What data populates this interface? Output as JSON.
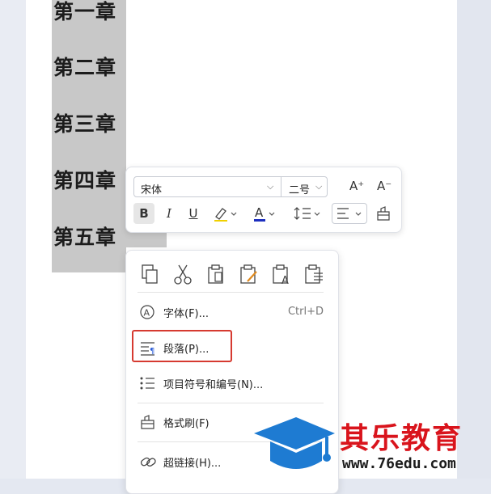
{
  "document": {
    "chapters": [
      "第一章",
      "第二章",
      "第三章",
      "第四章",
      "第五章"
    ]
  },
  "toolbar": {
    "font_name": "宋体",
    "font_size": "二号",
    "grow_label": "A⁺",
    "shrink_label": "A⁻",
    "bold_label": "B",
    "italic_label": "I",
    "underline_label": "U",
    "font_color": "#1d2fbf",
    "highlight_color": "#f0d000"
  },
  "context_menu": {
    "items": [
      {
        "label": "字体(F)...",
        "shortcut": "Ctrl+D",
        "icon": "font-circle-icon"
      },
      {
        "label": "段落(P)...",
        "icon": "paragraph-icon"
      },
      {
        "label": "项目符号和编号(N)...",
        "icon": "bullet-list-icon"
      },
      {
        "label": "格式刷(F)",
        "icon": "format-painter-icon"
      },
      {
        "label": "超链接(H)...",
        "icon": "link-icon"
      }
    ],
    "clipboard_icons": [
      "copy-icon",
      "cut-icon",
      "paste-icon",
      "paste-format-icon",
      "paste-text-icon",
      "paste-special-icon"
    ],
    "highlight_color": "#d63a30"
  },
  "watermark": {
    "title": "其乐教育",
    "url": "www.76edu.com"
  }
}
